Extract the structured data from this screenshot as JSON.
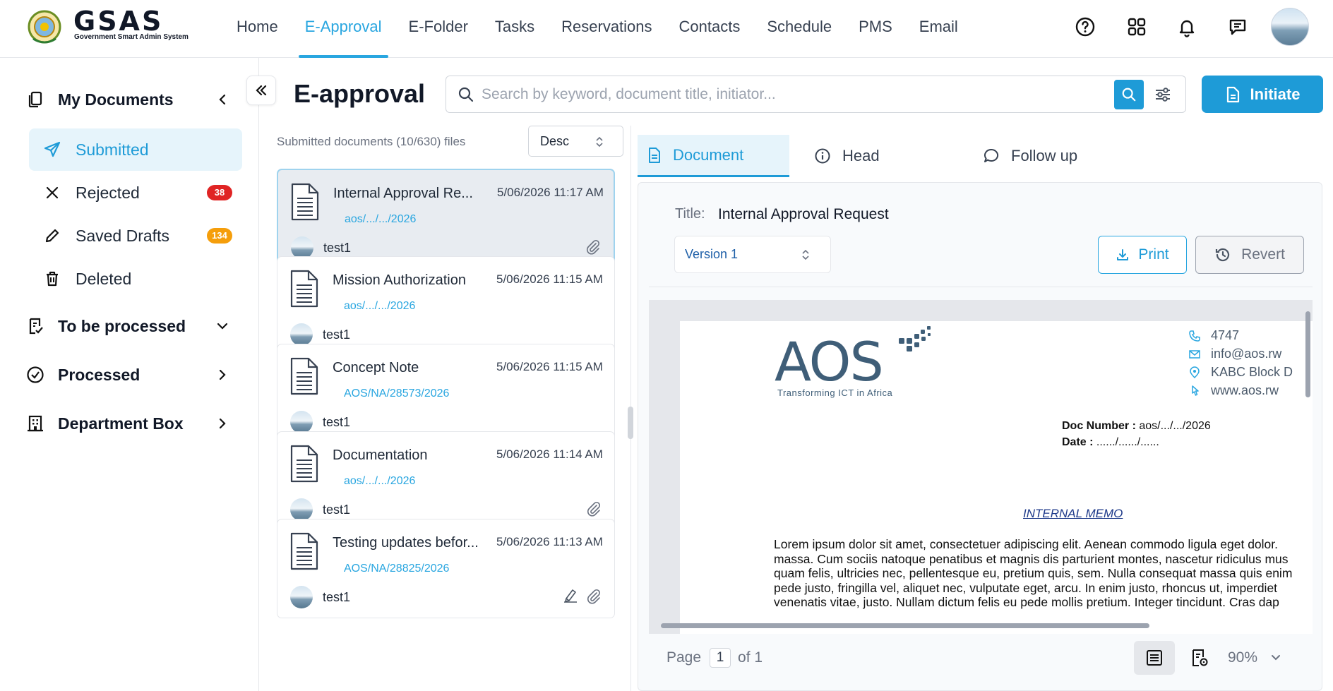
{
  "header": {
    "logo_text": "GSAS",
    "logo_subtitle": "Government Smart Admin System",
    "nav": [
      {
        "label": "Home"
      },
      {
        "label": "E-Approval"
      },
      {
        "label": "E-Folder"
      },
      {
        "label": "Tasks"
      },
      {
        "label": "Reservations"
      },
      {
        "label": "Contacts"
      },
      {
        "label": "Schedule"
      },
      {
        "label": "PMS"
      },
      {
        "label": "Email"
      }
    ],
    "active_nav": "E-Approval",
    "icons": [
      "help-icon",
      "apps-grid-icon",
      "bell-icon",
      "chat-icon"
    ]
  },
  "sidebar": {
    "my_documents": "My Documents",
    "items": [
      {
        "label": "Submitted",
        "icon": "send-icon"
      },
      {
        "label": "Rejected",
        "icon": "x-icon",
        "badge": "38"
      },
      {
        "label": "Saved Drafts",
        "icon": "pencil-icon",
        "badge": "134"
      },
      {
        "label": "Deleted",
        "icon": "trash-icon"
      }
    ],
    "to_be_processed": "To be processed",
    "processed": "Processed",
    "department_box": "Department Box"
  },
  "main": {
    "title": "E-approval",
    "search_placeholder": "Search by keyword, document title, initiator...",
    "initiate_label": "Initiate",
    "list_header": "Submitted documents (10/630) files",
    "sort_value": "Desc",
    "documents": [
      {
        "title": "Internal Approval Re...",
        "date": "5/06/2026 11:17 AM",
        "ref": "aos/.../.../2026",
        "user": "test1",
        "attachment": true
      },
      {
        "title": "Mission Authorization",
        "date": "5/06/2026 11:15 AM",
        "ref": "aos/.../.../2026",
        "user": "test1",
        "attachment": false
      },
      {
        "title": "Concept Note",
        "date": "5/06/2026 11:15 AM",
        "ref": "AOS/NA/28573/2026",
        "user": "test1",
        "attachment": false
      },
      {
        "title": "Documentation",
        "date": "5/06/2026 11:14 AM",
        "ref": "aos/.../.../2026",
        "user": "test1",
        "attachment": true
      },
      {
        "title": "Testing updates befor...",
        "date": "5/06/2026 11:13 AM",
        "ref": "AOS/NA/28825/2026",
        "user": "test1",
        "attachment": true,
        "signed": true
      }
    ]
  },
  "detail": {
    "tabs": [
      "Document",
      "Head",
      "Follow up"
    ],
    "title_label": "Title:",
    "title_value": "Internal Approval Request",
    "version": "Version 1",
    "print_label": "Print",
    "revert_label": "Revert",
    "preview": {
      "logo": "AOS",
      "tagline": "Transforming ICT in Africa",
      "phone": "4747",
      "email": "info@aos.rw",
      "address": "KABC Block D",
      "website": "www.aos.rw",
      "doc_number_label": "Doc  Number  :",
      "doc_number_value": "aos/.../.../2026",
      "date_label": "Date  :",
      "date_value": "....../....../......",
      "memo_heading": "INTERNAL MEMO",
      "body_lines": [
        "Lorem ipsum dolor sit amet, consectetuer adipiscing elit. Aenean commodo ligula eget dolor.",
        "massa. Cum sociis natoque penatibus et magnis dis parturient montes, nascetur ridiculus mus",
        "quam felis, ultricies nec, pellentesque eu, pretium quis, sem. Nulla consequat massa quis enim",
        "pede justo, fringilla vel, aliquet nec, vulputate eget, arcu. In enim justo, rhoncus ut, imperdiet",
        "venenatis vitae, justo. Nullam dictum felis eu pede mollis pretium. Integer tincidunt. Cras dap"
      ]
    },
    "pager": {
      "page_label": "Page",
      "page": "1",
      "of_label": "of 1"
    },
    "zoom": "90%"
  }
}
